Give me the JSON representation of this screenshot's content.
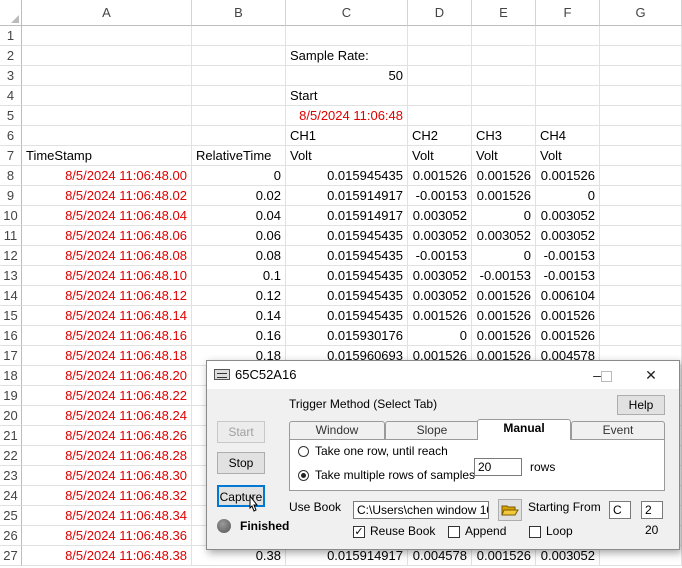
{
  "columns": [
    "A",
    "B",
    "C",
    "D",
    "E",
    "F",
    "G"
  ],
  "rows": [
    {
      "n": "1",
      "A": "",
      "B": "",
      "C": "",
      "D": "",
      "E": "",
      "F": ""
    },
    {
      "n": "2",
      "A": "",
      "B": "",
      "C": "Sample Rate:",
      "D": "",
      "E": "",
      "F": ""
    },
    {
      "n": "3",
      "A": "",
      "B": "",
      "C": "50",
      "D": "",
      "E": "",
      "F": ""
    },
    {
      "n": "4",
      "A": "",
      "B": "",
      "C": "Start",
      "D": "",
      "E": "",
      "F": ""
    },
    {
      "n": "5",
      "A": "",
      "B": "",
      "C": "8/5/2024 11:06:48",
      "D": "",
      "E": "",
      "F": ""
    },
    {
      "n": "6",
      "A": "",
      "B": "",
      "C": "CH1",
      "D": "CH2",
      "E": "CH3",
      "F": "CH4"
    },
    {
      "n": "7",
      "A": "TimeStamp",
      "B": "RelativeTime",
      "C": "Volt",
      "D": "Volt",
      "E": "Volt",
      "F": "Volt"
    },
    {
      "n": "8",
      "A": "8/5/2024 11:06:48.00",
      "B": "0",
      "C": "0.015945435",
      "D": "0.001526",
      "E": "0.001526",
      "F": "0.001526"
    },
    {
      "n": "9",
      "A": "8/5/2024 11:06:48.02",
      "B": "0.02",
      "C": "0.015914917",
      "D": "-0.00153",
      "E": "0.001526",
      "F": "0"
    },
    {
      "n": "10",
      "A": "8/5/2024 11:06:48.04",
      "B": "0.04",
      "C": "0.015914917",
      "D": "0.003052",
      "E": "0",
      "F": "0.003052"
    },
    {
      "n": "11",
      "A": "8/5/2024 11:06:48.06",
      "B": "0.06",
      "C": "0.015945435",
      "D": "0.003052",
      "E": "0.003052",
      "F": "0.003052"
    },
    {
      "n": "12",
      "A": "8/5/2024 11:06:48.08",
      "B": "0.08",
      "C": "0.015945435",
      "D": "-0.00153",
      "E": "0",
      "F": "-0.00153"
    },
    {
      "n": "13",
      "A": "8/5/2024 11:06:48.10",
      "B": "0.1",
      "C": "0.015945435",
      "D": "0.003052",
      "E": "-0.00153",
      "F": "-0.00153"
    },
    {
      "n": "14",
      "A": "8/5/2024 11:06:48.12",
      "B": "0.12",
      "C": "0.015945435",
      "D": "0.003052",
      "E": "0.001526",
      "F": "0.006104"
    },
    {
      "n": "15",
      "A": "8/5/2024 11:06:48.14",
      "B": "0.14",
      "C": "0.015945435",
      "D": "0.001526",
      "E": "0.001526",
      "F": "0.001526"
    },
    {
      "n": "16",
      "A": "8/5/2024 11:06:48.16",
      "B": "0.16",
      "C": "0.015930176",
      "D": "0",
      "E": "0.001526",
      "F": "0.001526"
    },
    {
      "n": "17",
      "A": "8/5/2024 11:06:48.18",
      "B": "0.18",
      "C": "0.015960693",
      "D": "0.001526",
      "E": "0.001526",
      "F": "0.004578"
    },
    {
      "n": "18",
      "A": "8/5/2024 11:06:48.20",
      "B": "",
      "C": "",
      "D": "",
      "E": "",
      "F": ""
    },
    {
      "n": "19",
      "A": "8/5/2024 11:06:48.22",
      "B": "",
      "C": "",
      "D": "",
      "E": "",
      "F": ""
    },
    {
      "n": "20",
      "A": "8/5/2024 11:06:48.24",
      "B": "",
      "C": "",
      "D": "",
      "E": "",
      "F": ""
    },
    {
      "n": "21",
      "A": "8/5/2024 11:06:48.26",
      "B": "",
      "C": "",
      "D": "",
      "E": "",
      "F": ""
    },
    {
      "n": "22",
      "A": "8/5/2024 11:06:48.28",
      "B": "",
      "C": "",
      "D": "",
      "E": "",
      "F": ""
    },
    {
      "n": "23",
      "A": "8/5/2024 11:06:48.30",
      "B": "",
      "C": "",
      "D": "",
      "E": "",
      "F": ""
    },
    {
      "n": "24",
      "A": "8/5/2024 11:06:48.32",
      "B": "",
      "C": "",
      "D": "",
      "E": "",
      "F": ""
    },
    {
      "n": "25",
      "A": "8/5/2024 11:06:48.34",
      "B": "",
      "C": "",
      "D": "",
      "E": "",
      "F": ""
    },
    {
      "n": "26",
      "A": "8/5/2024 11:06:48.36",
      "B": "",
      "C": "",
      "D": "",
      "E": "",
      "F": ""
    },
    {
      "n": "27",
      "A": "8/5/2024 11:06:48.38",
      "B": "0.38",
      "C": "0.015914917",
      "D": "0.004578",
      "E": "0.001526",
      "F": "0.003052"
    }
  ],
  "colors": {
    "timestamp_red": "#e00000",
    "grid": "#e1e1e1"
  },
  "dialog": {
    "title": "65C52A16",
    "trigger_label": "Trigger Method (Select Tab)",
    "help_label": "Help",
    "start_label": "Start",
    "stop_label": "Stop",
    "capture_label": "Capture",
    "status_label": "Finished",
    "tabs": [
      "Window",
      "Slope",
      "Manual",
      "Event"
    ],
    "active_tab": "Manual",
    "option_one_row": "Take one row, until reach",
    "option_multi_rows": "Take multiple rows of samples",
    "rows_value": "20",
    "rows_label": "rows",
    "use_book_label": "Use Book",
    "book_path": "C:\\Users\\chen window 10\\",
    "starting_from_label": "Starting From",
    "start_col": "C",
    "start_row": "2",
    "reuse_book_label": "Reuse Book",
    "append_label": "Append",
    "loop_label": "Loop",
    "count_value": "20",
    "icons": {
      "app": "device-icon",
      "minimize": "minimize-icon",
      "maximize": "maximize-icon",
      "close": "close-icon",
      "folder": "folder-open-icon",
      "status": "status-led-icon",
      "cursor": "mouse-pointer-icon"
    }
  }
}
